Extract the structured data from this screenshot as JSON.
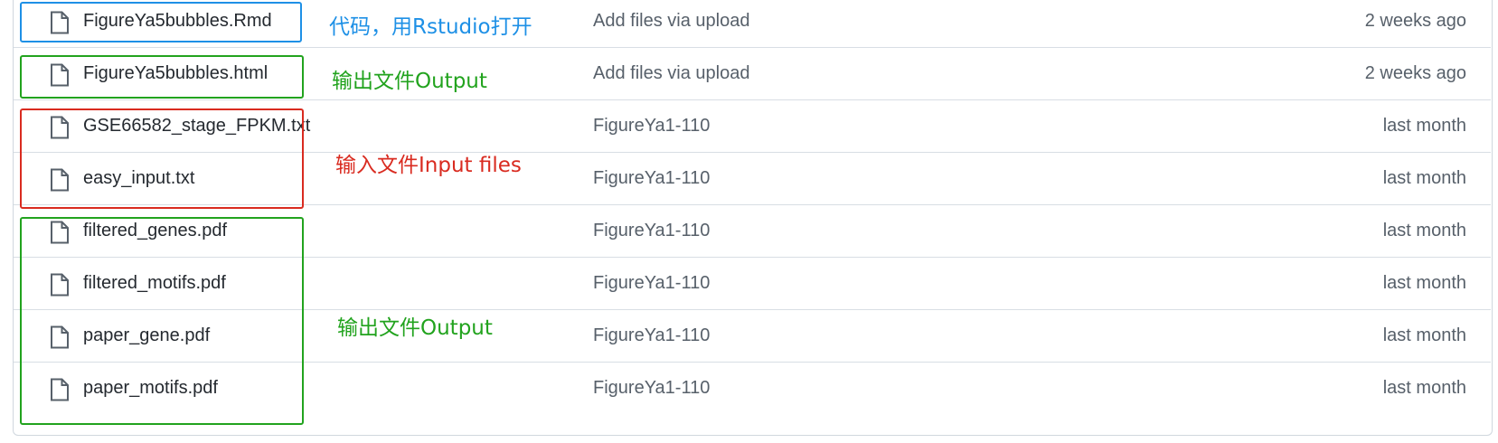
{
  "files": [
    {
      "name": "FigureYa5bubbles.Rmd",
      "commit": "Add files via upload",
      "date": "2 weeks ago",
      "icon": "file-icon"
    },
    {
      "name": "FigureYa5bubbles.html",
      "commit": "Add files via upload",
      "date": "2 weeks ago",
      "icon": "file-icon"
    },
    {
      "name": "GSE66582_stage_FPKM.txt",
      "commit": "FigureYa1-110",
      "date": "last month",
      "icon": "file-icon"
    },
    {
      "name": "easy_input.txt",
      "commit": "FigureYa1-110",
      "date": "last month",
      "icon": "file-icon"
    },
    {
      "name": "filtered_genes.pdf",
      "commit": "FigureYa1-110",
      "date": "last month",
      "icon": "file-icon"
    },
    {
      "name": "filtered_motifs.pdf",
      "commit": "FigureYa1-110",
      "date": "last month",
      "icon": "file-icon"
    },
    {
      "name": "paper_gene.pdf",
      "commit": "FigureYa1-110",
      "date": "last month",
      "icon": "file-icon"
    },
    {
      "name": "paper_motifs.pdf",
      "commit": "FigureYa1-110",
      "date": "last month",
      "icon": "file-icon"
    }
  ],
  "annotations": [
    {
      "text": "代码，用Rstudio打开",
      "color": "#1e90e6"
    },
    {
      "text": "输出文件Output",
      "color": "#22a31e"
    },
    {
      "text": "输入文件Input files",
      "color": "#d92b20"
    },
    {
      "text": "输出文件Output",
      "color": "#22a31e"
    }
  ],
  "colors": {
    "file_text": "#24292f",
    "muted_text": "#57606a",
    "border": "#d0d7de",
    "annotation_blue": "#1e90e6",
    "annotation_green": "#22a31e",
    "annotation_red": "#d92b20"
  }
}
